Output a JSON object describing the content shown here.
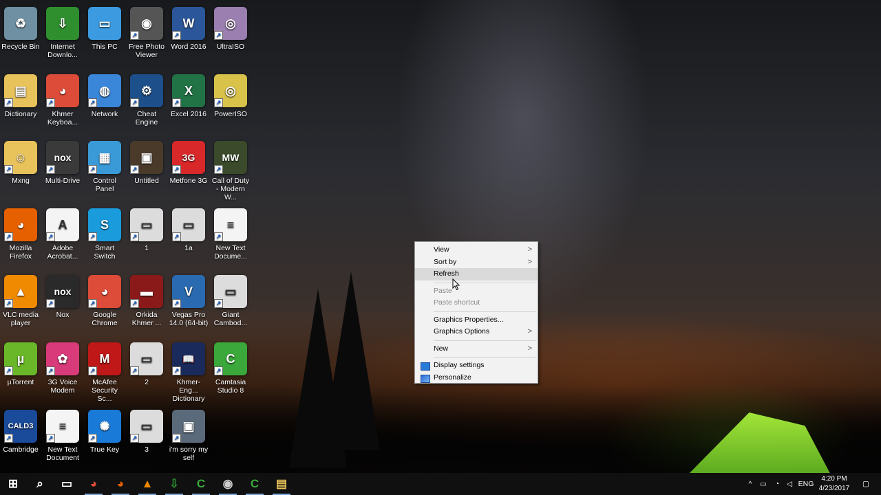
{
  "desktop_icons": [
    {
      "label": "Recycle Bin",
      "icon": "recycle-bin-icon",
      "color": "#6f8fa3",
      "glyph": "♻"
    },
    {
      "label": "Internet Downlo...",
      "icon": "idm-icon",
      "color": "#2f8f2f",
      "glyph": "⇩"
    },
    {
      "label": "This PC",
      "icon": "this-pc-icon",
      "color": "#3c9be0",
      "glyph": "▭"
    },
    {
      "label": "Free Photo Viewer",
      "icon": "camera-icon",
      "color": "#555555",
      "glyph": "◉"
    },
    {
      "label": "Word 2016",
      "icon": "word-icon",
      "color": "#2b579a",
      "glyph": "W"
    },
    {
      "label": "UltraISO",
      "icon": "disc-icon",
      "color": "#9a7fb0",
      "glyph": "◎"
    },
    {
      "label": "Dictionary",
      "icon": "folder-icon",
      "color": "#e8c25a",
      "glyph": "▤"
    },
    {
      "label": "Khmer Keyboa...",
      "icon": "chrome-icon",
      "color": "#dd4b39",
      "glyph": "◕"
    },
    {
      "label": "Network",
      "icon": "network-icon",
      "color": "#3a86d8",
      "glyph": "◍"
    },
    {
      "label": "Cheat Engine",
      "icon": "cheat-engine-icon",
      "color": "#1d4f8a",
      "glyph": "⚙"
    },
    {
      "label": "Excel 2016",
      "icon": "excel-icon",
      "color": "#217346",
      "glyph": "X"
    },
    {
      "label": "PowerISO",
      "icon": "poweriso-icon",
      "color": "#d8c24a",
      "glyph": "◎"
    },
    {
      "label": "Mxng",
      "icon": "user-folder-icon",
      "color": "#e8c25a",
      "glyph": "☺"
    },
    {
      "label": "Multi-Drive",
      "icon": "nox-icon",
      "color": "#3a3a3a",
      "glyph": "nox"
    },
    {
      "label": "Control Panel",
      "icon": "control-panel-icon",
      "color": "#3a9ad8",
      "glyph": "▦"
    },
    {
      "label": "Untitled",
      "icon": "photo-thumbnail-icon",
      "color": "#4a3a2a",
      "glyph": "▣"
    },
    {
      "label": "Metfone 3G",
      "icon": "metfone-icon",
      "color": "#d8282a",
      "glyph": "3G"
    },
    {
      "label": "Call of Duty - Modern W...",
      "icon": "call-of-duty-icon",
      "color": "#3a4a2a",
      "glyph": "MW"
    },
    {
      "label": "Mozilla Firefox",
      "icon": "firefox-icon",
      "color": "#e66000",
      "glyph": "◕"
    },
    {
      "label": "Adobe Acrobat...",
      "icon": "acrobat-icon",
      "color": "#f4f4f4",
      "glyph": "A",
      "dark": true
    },
    {
      "label": "Smart Switch",
      "icon": "smart-switch-icon",
      "color": "#1a9bdc",
      "glyph": "S"
    },
    {
      "label": "1",
      "icon": "screenshot-thumbnail-icon",
      "color": "#dcdcdc",
      "glyph": "▭",
      "dark": true
    },
    {
      "label": "1a",
      "icon": "screenshot-thumbnail-icon",
      "color": "#dcdcdc",
      "glyph": "▭",
      "dark": true
    },
    {
      "label": "New Text Docume...",
      "icon": "text-document-icon",
      "color": "#f4f4f4",
      "glyph": "≡",
      "dark": true
    },
    {
      "label": "VLC media player",
      "icon": "vlc-icon",
      "color": "#f08a00",
      "glyph": "▲"
    },
    {
      "label": "Nox",
      "icon": "nox-icon",
      "color": "#2a2a2a",
      "glyph": "nox"
    },
    {
      "label": "Google Chrome",
      "icon": "chrome-icon",
      "color": "#dd4b39",
      "glyph": "◕"
    },
    {
      "label": "Orkida Khmer ...",
      "icon": "book-icon",
      "color": "#8a1a1a",
      "glyph": "▬"
    },
    {
      "label": "Vegas Pro 14.0 (64-bit)",
      "icon": "vegas-icon",
      "color": "#2a6ab0",
      "glyph": "V"
    },
    {
      "label": "Giant Cambod...",
      "icon": "screenshot-thumbnail-icon",
      "color": "#dcdcdc",
      "glyph": "▭",
      "dark": true
    },
    {
      "label": "µTorrent",
      "icon": "utorrent-icon",
      "color": "#6ab82a",
      "glyph": "µ"
    },
    {
      "label": "3G Voice Modem",
      "icon": "flower-icon",
      "color": "#d83a7a",
      "glyph": "✿"
    },
    {
      "label": "McAfee Security Sc...",
      "icon": "mcafee-icon",
      "color": "#c01818",
      "glyph": "M"
    },
    {
      "label": "2",
      "icon": "screenshot-thumbnail-icon",
      "color": "#dcdcdc",
      "glyph": "▭",
      "dark": true
    },
    {
      "label": "Khmer-Eng... Dictionary",
      "icon": "dictionary-icon",
      "color": "#1a2a5a",
      "glyph": "📖"
    },
    {
      "label": "Camtasia Studio 8",
      "icon": "camtasia-icon",
      "color": "#3aa83a",
      "glyph": "C"
    },
    {
      "label": "Cambridge",
      "icon": "cambridge-icon",
      "color": "#1a4a9a",
      "glyph": "CALD3"
    },
    {
      "label": "New Text Document",
      "icon": "text-document-icon",
      "color": "#f4f4f4",
      "glyph": "≡",
      "dark": true
    },
    {
      "label": "True Key",
      "icon": "true-key-icon",
      "color": "#1a7ad8",
      "glyph": "✺"
    },
    {
      "label": "3",
      "icon": "screenshot-thumbnail-icon",
      "color": "#dcdcdc",
      "glyph": "▭",
      "dark": true
    },
    {
      "label": "i'm sorry my self",
      "icon": "photo-thumbnail-icon",
      "color": "#5a6a7a",
      "glyph": "▣"
    }
  ],
  "context_menu": {
    "items": [
      {
        "label": "View",
        "submenu": true
      },
      {
        "label": "Sort by",
        "submenu": true
      },
      {
        "label": "Refresh",
        "hover": true
      },
      {
        "sep": true
      },
      {
        "label": "Paste",
        "disabled": true
      },
      {
        "label": "Paste shortcut",
        "disabled": true
      },
      {
        "sep": true
      },
      {
        "label": "Graphics Properties..."
      },
      {
        "label": "Graphics Options",
        "submenu": true
      },
      {
        "sep": true
      },
      {
        "label": "New",
        "submenu": true
      },
      {
        "sep": true
      },
      {
        "label": "Display settings",
        "icon": "display-settings-icon"
      },
      {
        "label": "Personalize",
        "icon": "personalize-icon"
      }
    ],
    "arrow_glyph": ">"
  },
  "taskbar": {
    "pinned": [
      {
        "name": "start-button",
        "glyph": "⊞",
        "color": "#ffffff"
      },
      {
        "name": "search-button",
        "glyph": "⌕",
        "color": "#ffffff"
      },
      {
        "name": "task-view-button",
        "glyph": "▭",
        "color": "#ffffff"
      },
      {
        "name": "taskbar-chrome",
        "glyph": "◕",
        "color": "#dd4b39"
      },
      {
        "name": "taskbar-firefox",
        "glyph": "◕",
        "color": "#e66000"
      },
      {
        "name": "taskbar-vlc",
        "glyph": "▲",
        "color": "#f08a00"
      },
      {
        "name": "taskbar-idm",
        "glyph": "⇩",
        "color": "#2f8f2f"
      },
      {
        "name": "taskbar-camtasia",
        "glyph": "C",
        "color": "#3aa83a"
      },
      {
        "name": "taskbar-photo-viewer",
        "glyph": "◉",
        "color": "#cccccc"
      },
      {
        "name": "taskbar-camtasia-recorder",
        "glyph": "C",
        "color": "#3aa83a"
      },
      {
        "name": "taskbar-file-explorer",
        "glyph": "▤",
        "color": "#e8c25a"
      }
    ],
    "tray": {
      "chevron": "^",
      "language": "ENG",
      "time": "4:20 PM",
      "date": "4/23/2017"
    }
  }
}
